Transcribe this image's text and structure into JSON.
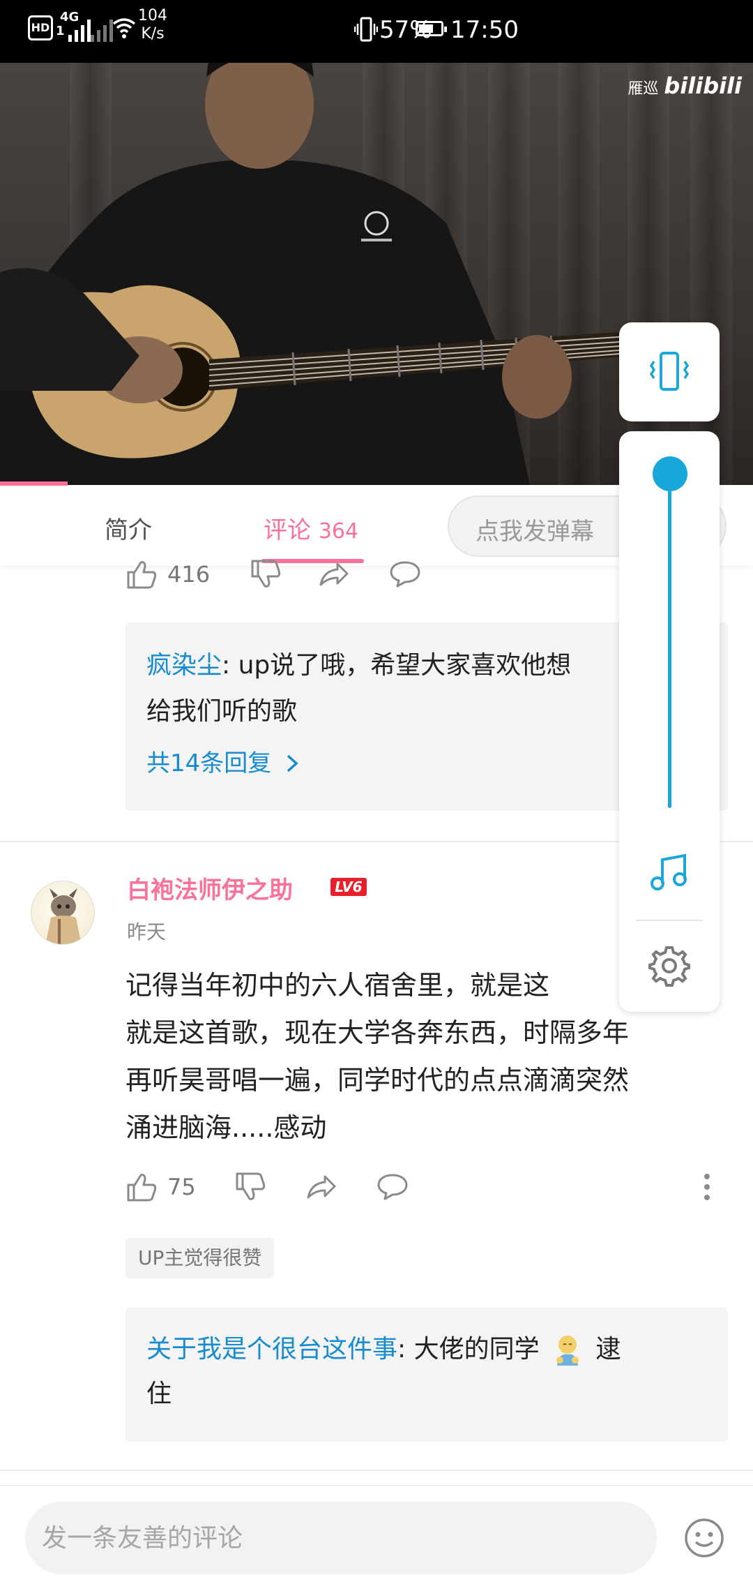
{
  "status_bar": {
    "hd": "HD",
    "sim": "1",
    "network": "4G",
    "speed_value": "104",
    "speed_unit": "K/s",
    "battery": "57%",
    "time": "17:50"
  },
  "video": {
    "watermark_cn": "雁巡",
    "watermark_logo": "bilibili",
    "progress_fraction": 0.09
  },
  "tabs": {
    "intro": "简介",
    "comments": "评论",
    "comments_count": "364",
    "danmaku_placeholder": "点我发弹幕"
  },
  "comment1": {
    "likes": "416"
  },
  "reply1": {
    "user": "疯染尘",
    "text_line1": ": up说了哦，希望大家喜欢他想",
    "text_line2": "给我们听的歌",
    "more": "共14条回复"
  },
  "comment2": {
    "username": "白袍法师伊之助",
    "level": "LV6",
    "time": "昨天",
    "lines": [
      "记得当年初中的六人宿舍里，就是这",
      "就是这首歌，现在大学各奔东西，时隔多年",
      "再听昊哥唱一遍，同学时代的点点滴滴突然",
      "涌进脑海.....感动"
    ],
    "likes": "75",
    "badge": "UP主觉得很赞"
  },
  "reply2": {
    "user": "关于我是个很台这件事",
    "text_before": ": 大佬的同学 ",
    "text_after": " 逮",
    "text_line2": "住"
  },
  "bottom": {
    "placeholder": "发一条友善的评论"
  },
  "colors": {
    "accent": "#fb7299",
    "link": "#178bcf",
    "panel_blue": "#17a7d9"
  },
  "icons": [
    "vibrate-icon",
    "music-note-icon",
    "gear-icon",
    "thumb-up-icon",
    "thumb-down-icon",
    "share-icon",
    "reply-icon",
    "more-icon",
    "emoji-icon",
    "chevron-right-icon",
    "wifi-icon",
    "battery-icon"
  ]
}
